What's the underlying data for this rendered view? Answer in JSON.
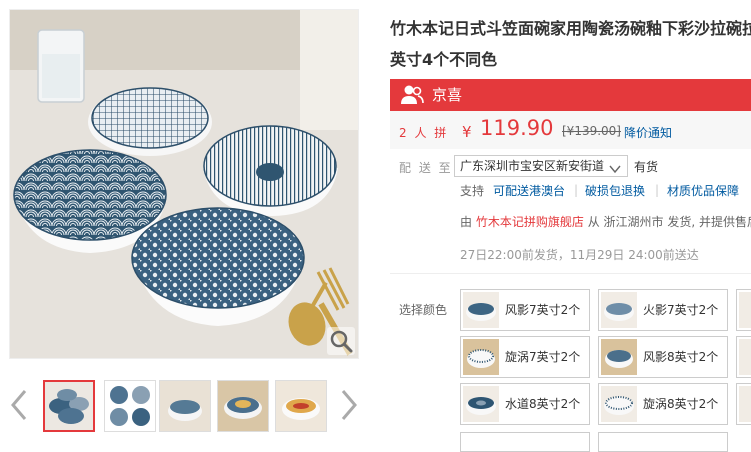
{
  "gallery": {
    "thumbnails": [
      "thumb-1",
      "thumb-2",
      "thumb-3",
      "thumb-4",
      "thumb-5"
    ],
    "active_index": 0
  },
  "product": {
    "title_line1": "竹木本记日式斗笠面碗家用陶瓷汤碗釉下彩沙拉碗拉",
    "title_line2": "英寸4个不同色"
  },
  "promo": {
    "label": "京喜",
    "icon": "group-users-icon",
    "color": "#e4393c"
  },
  "price": {
    "group_label": "2 人 拼",
    "currency": "¥",
    "current": "119.90",
    "original": "[¥139.00]",
    "notify": "降价通知"
  },
  "shipping": {
    "label": "配 送 至",
    "location": "广东深圳市宝安区新安街道",
    "stock": "有货"
  },
  "services": {
    "label": "支持",
    "items": [
      "可配送港澳台",
      "破损包退换",
      "材质优品保障"
    ]
  },
  "store": {
    "prefix": "由",
    "name": "竹木本记拼购旗舰店",
    "suffix": "从 浙江湖州市 发货, 并提供售后"
  },
  "delivery": {
    "text": "27日22:00前发货，11月29日 24:00前送达"
  },
  "options": {
    "label": "选择颜色",
    "items": [
      "风影7英寸2个",
      "火影7英寸2个",
      "旋涡7英寸2个",
      "风影8英寸2个",
      "水道8英寸2个",
      "旋涡8英寸2个"
    ]
  }
}
